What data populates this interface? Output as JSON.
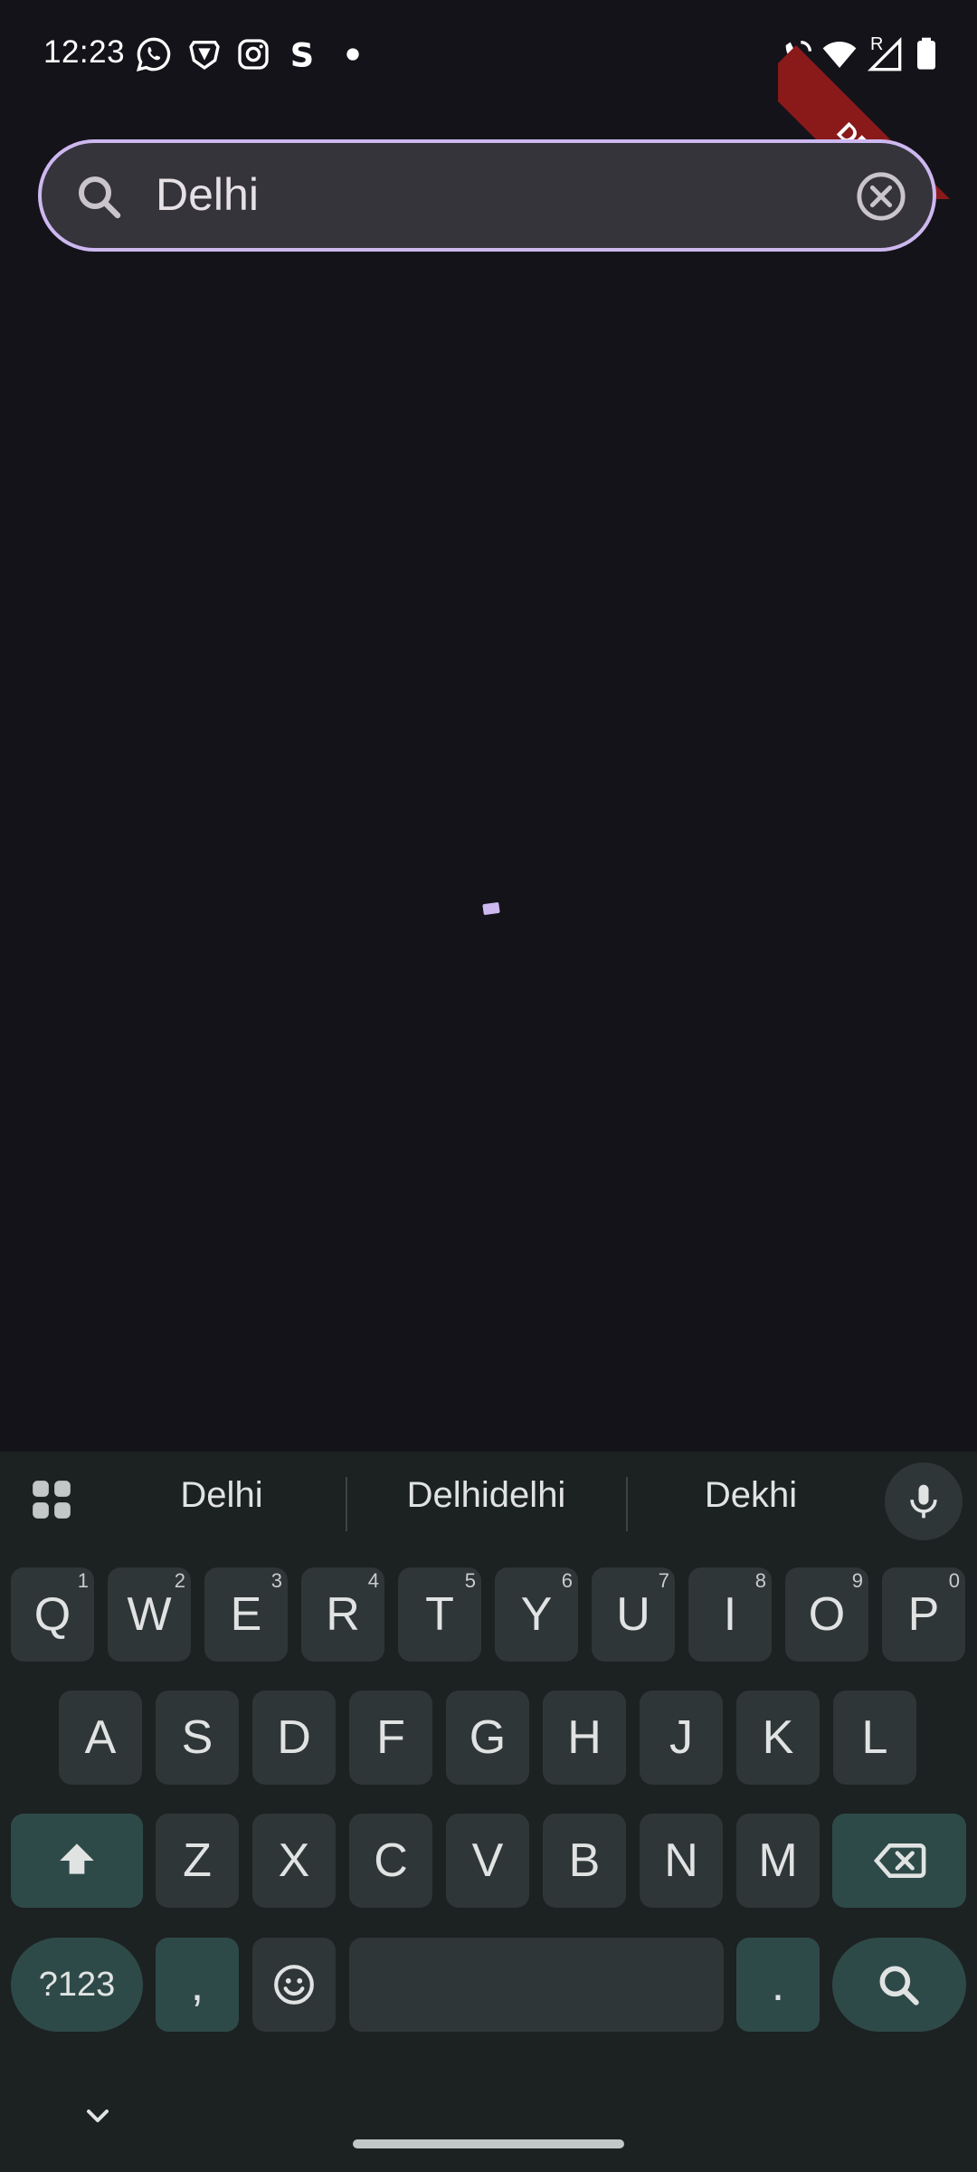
{
  "status_bar": {
    "time": "12:23",
    "icons_left": [
      "whatsapp-icon",
      "brave-icon",
      "instagram-icon",
      "s-app-icon",
      "dot-icon"
    ],
    "icons_right": [
      "wifi-call-icon",
      "wifi-icon",
      "signal-icon",
      "battery-icon"
    ],
    "signal_badge": "R",
    "debug_banner": "DEBUG"
  },
  "search": {
    "value": "Delhi",
    "accent_color": "#cdb8f0"
  },
  "keyboard": {
    "suggestions": [
      "Delhi",
      "Delhidelhi",
      "Dekhi"
    ],
    "row1": [
      {
        "label": "Q",
        "num": "1"
      },
      {
        "label": "W",
        "num": "2"
      },
      {
        "label": "E",
        "num": "3"
      },
      {
        "label": "R",
        "num": "4"
      },
      {
        "label": "T",
        "num": "5"
      },
      {
        "label": "Y",
        "num": "6"
      },
      {
        "label": "U",
        "num": "7"
      },
      {
        "label": "I",
        "num": "8"
      },
      {
        "label": "O",
        "num": "9"
      },
      {
        "label": "P",
        "num": "0"
      }
    ],
    "row2": [
      "A",
      "S",
      "D",
      "F",
      "G",
      "H",
      "J",
      "K",
      "L"
    ],
    "row3": [
      "Z",
      "X",
      "C",
      "V",
      "B",
      "N",
      "M"
    ],
    "symbols_label": "?123",
    "comma_label": ",",
    "period_label": "."
  }
}
